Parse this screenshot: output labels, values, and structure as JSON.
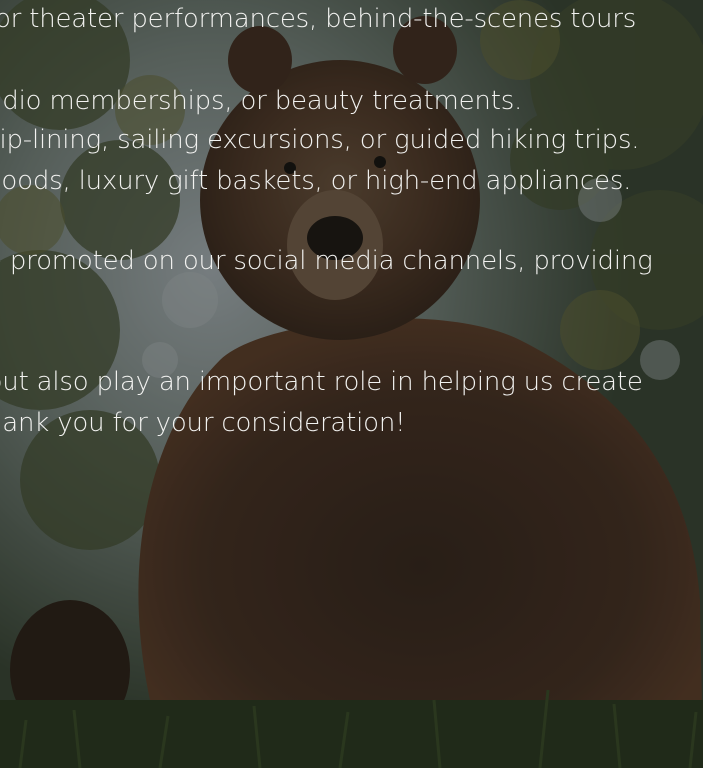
{
  "content": {
    "lines": [
      "for theater performances, behind-the-scenes tours",
      "udio memberships, or beauty treatments.",
      "zip-lining, sailing excursions, or guided hiking trips.",
      "goods, luxury gift baskets, or high-end appliances.",
      "e promoted on our social media channels, providing",
      "but also play an important role in helping us create",
      "hank you for your consideration!"
    ]
  },
  "background": {
    "subject": "grizzly-bear-photo",
    "overlay_color": "#141816"
  }
}
